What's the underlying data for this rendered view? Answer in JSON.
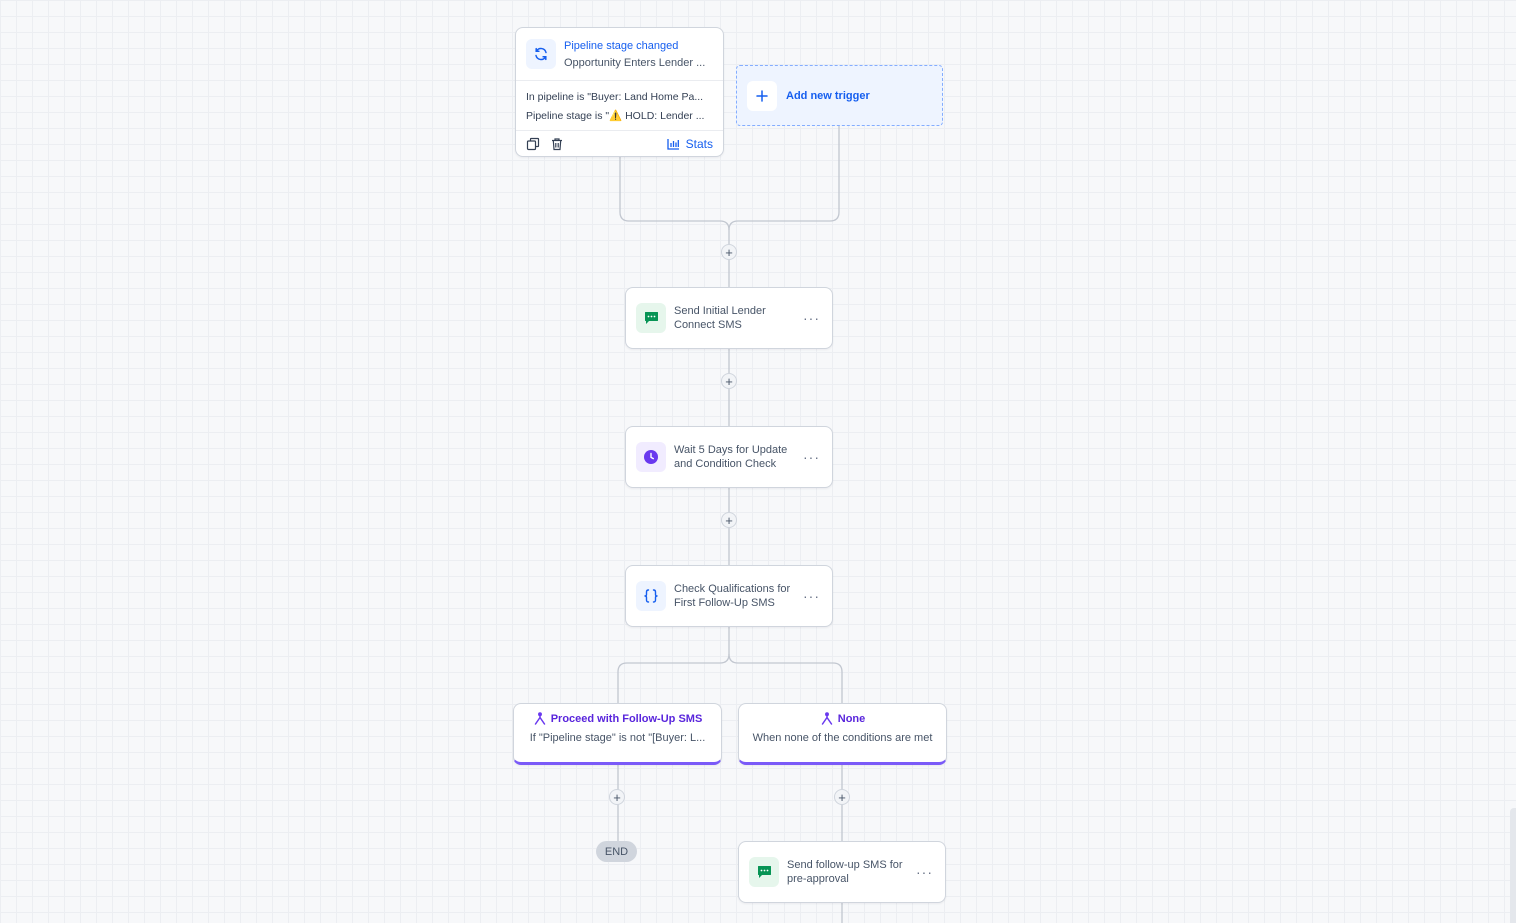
{
  "trigger": {
    "title": "Pipeline stage changed",
    "subtitle": "Opportunity Enters Lender ...",
    "filters": [
      "In pipeline is \"Buyer: Land Home Pa...",
      "Pipeline stage is \"⚠️ HOLD: Lender ..."
    ],
    "stats_label": "Stats",
    "icon": "refresh-icon"
  },
  "add_trigger": {
    "label": "Add new trigger"
  },
  "actions": [
    {
      "label": "Send Initial Lender Connect SMS",
      "icon": "sms-icon"
    },
    {
      "label": "Wait 5 Days for Update and Condition Check",
      "icon": "clock-icon"
    },
    {
      "label": "Check Qualifications for First Follow-Up SMS",
      "icon": "condition-braces-icon"
    }
  ],
  "branches": [
    {
      "title": "Proceed with Follow-Up SMS",
      "subtitle": "If \"Pipeline stage\" is not \"[Buyer: L..."
    },
    {
      "title": "None",
      "subtitle": "When none of the conditions are met"
    }
  ],
  "end_label": "END",
  "final_action": {
    "label": "Send follow-up SMS for pre-approval",
    "icon": "sms-icon"
  },
  "more_glyph": "···",
  "plus_glyph": "+",
  "colors": {
    "accent_blue": "#155eef",
    "branch_purple": "#7a5af8",
    "sms_green": "#079455"
  }
}
